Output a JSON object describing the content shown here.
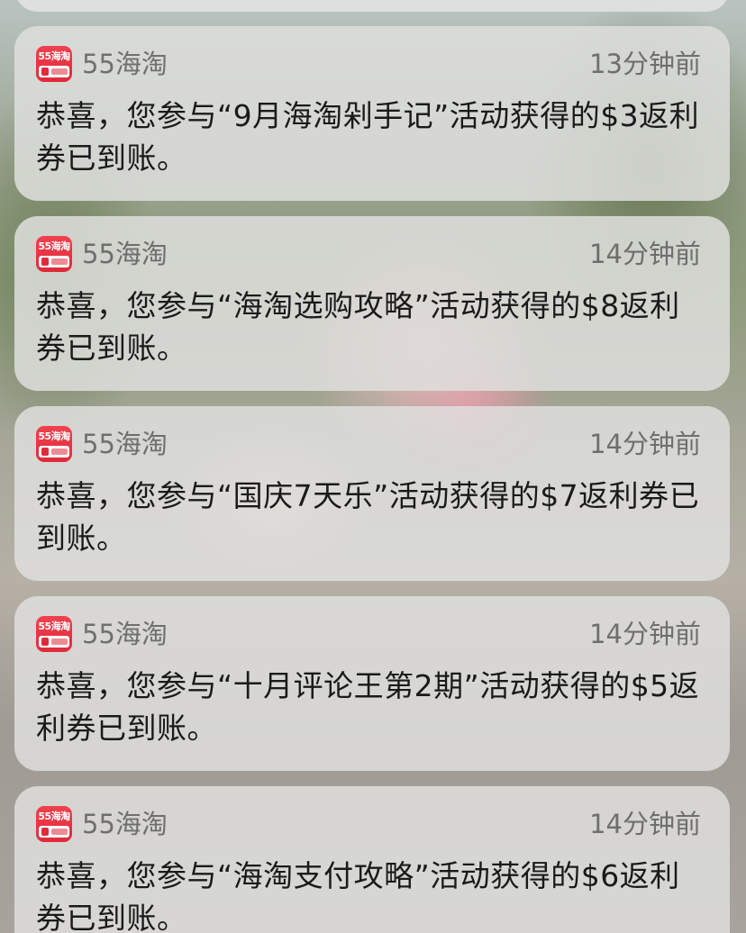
{
  "notifications": [
    {
      "app_name": "55海淘",
      "icon_label": "55海淘",
      "time": "13分钟前",
      "message": "恭喜，您参与“9月海淘剁手记”活动获得的$3返利券已到账。"
    },
    {
      "app_name": "55海淘",
      "icon_label": "55海淘",
      "time": "14分钟前",
      "message": "恭喜，您参与“海淘选购攻略”活动获得的$8返利券已到账。"
    },
    {
      "app_name": "55海淘",
      "icon_label": "55海淘",
      "time": "14分钟前",
      "message": "恭喜，您参与“国庆7天乐”活动获得的$7返利券已到账。"
    },
    {
      "app_name": "55海淘",
      "icon_label": "55海淘",
      "time": "14分钟前",
      "message": "恭喜，您参与“十月评论王第2期”活动获得的$5返利券已到账。"
    },
    {
      "app_name": "55海淘",
      "icon_label": "55海淘",
      "time": "14分钟前",
      "message": "恭喜，您参与“海淘支付攻略”活动获得的$6返利券已到账。"
    }
  ],
  "colors": {
    "icon_red": "#e02a3a",
    "card_background": "#dededc",
    "secondary_text": "#6e6e6e",
    "primary_text": "#1a1a1a"
  },
  "icons": {
    "app": "55haitao-app-icon"
  }
}
